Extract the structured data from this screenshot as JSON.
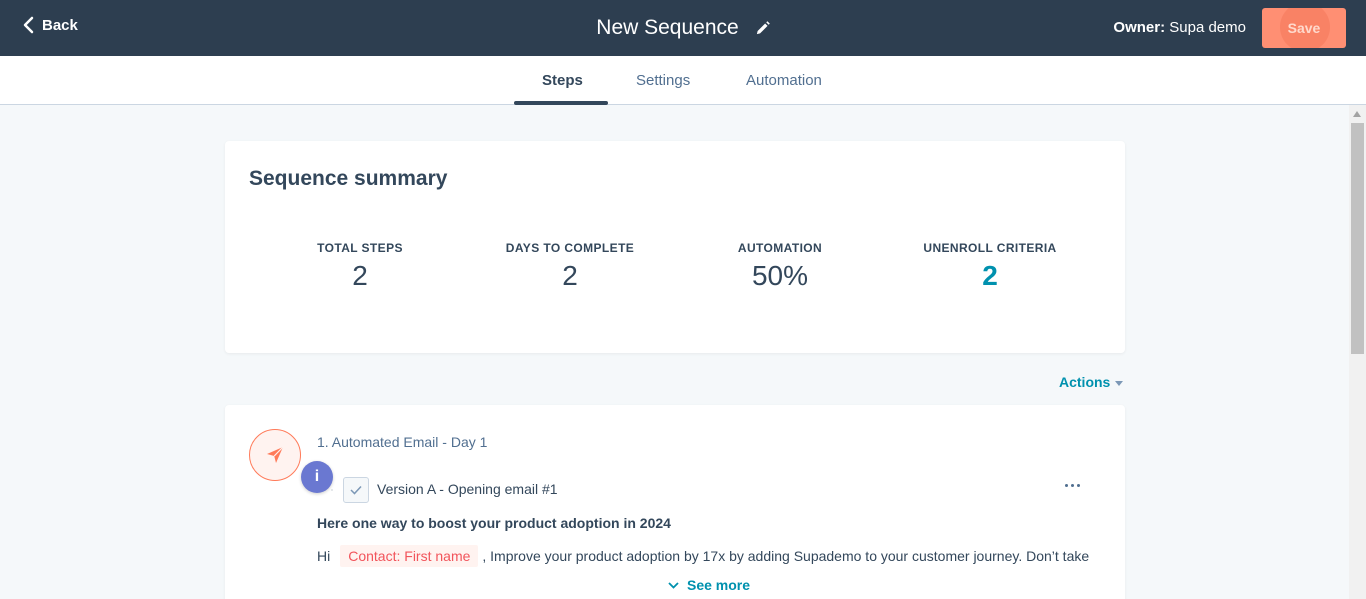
{
  "header": {
    "back_label": "Back",
    "title": "New Sequence",
    "owner_label": "Owner:",
    "owner_name": "Supa demo",
    "save_label": "Save"
  },
  "tabs": [
    {
      "label": "Steps",
      "active": true
    },
    {
      "label": "Settings",
      "active": false
    },
    {
      "label": "Automation",
      "active": false
    }
  ],
  "summary": {
    "title": "Sequence summary",
    "stats": [
      {
        "label": "TOTAL STEPS",
        "value": "2"
      },
      {
        "label": "DAYS TO COMPLETE",
        "value": "2"
      },
      {
        "label": "AUTOMATION",
        "value": "50%"
      },
      {
        "label": "UNENROLL CRITERIA",
        "value": "2"
      }
    ]
  },
  "actions_label": "Actions",
  "step": {
    "name": "1. Automated Email - Day 1",
    "info_badge": "i",
    "version": "Version A - Opening email #1",
    "subject": "Here one way to boost your product adoption in 2024",
    "body_prefix": "Hi",
    "token": "Contact: First name",
    "body_suffix": ", Improve your product adoption by 17x by adding Supademo to your customer journey. Don’t take",
    "see_more": "See more"
  },
  "colors": {
    "topbar": "#2d3e50",
    "accent": "#ff8f73",
    "link": "#0091ae",
    "info": "#6a78d1"
  },
  "icons": {
    "back": "chevron-left-icon",
    "edit": "pencil-icon",
    "step": "paper-plane-icon",
    "check": "check-icon",
    "more": "ellipsis-icon",
    "expand": "chevron-down-icon"
  }
}
